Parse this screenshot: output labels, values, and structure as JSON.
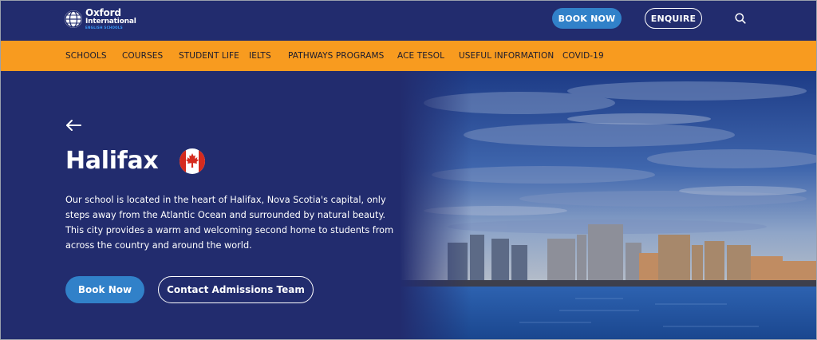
{
  "header": {
    "logo": {
      "main": "Oxford",
      "sub": "International",
      "tag": "ENGLISH SCHOOLS"
    },
    "book_label": "BOOK NOW",
    "enquire_label": "ENQUIRE",
    "search_icon": "search-icon"
  },
  "nav": {
    "items": [
      {
        "label": "SCHOOLS"
      },
      {
        "label": "COURSES"
      },
      {
        "label": "STUDENT LIFE"
      },
      {
        "label": "IELTS"
      },
      {
        "label": "PATHWAYS PROGRAMS"
      },
      {
        "label": "ACE TESOL"
      },
      {
        "label": "USEFUL INFORMATION"
      },
      {
        "label": "COVID-19"
      }
    ]
  },
  "hero": {
    "back_icon": "arrow-left-icon",
    "title": "Halifax",
    "flag_icon": "canada-flag-icon",
    "description": "Our school is located in the heart of Halifax, Nova Scotia's capital, only steps away from the Atlantic Ocean and surrounded by natural beauty. This city provides a warm and welcoming second home to students from across the country and around the world.",
    "book_label": "Book Now",
    "contact_label": "Contact Admissions Team"
  },
  "colors": {
    "navy": "#222c6e",
    "orange": "#f89b1f",
    "blue_button": "#3181c9",
    "flag_red": "#d52b1e"
  }
}
